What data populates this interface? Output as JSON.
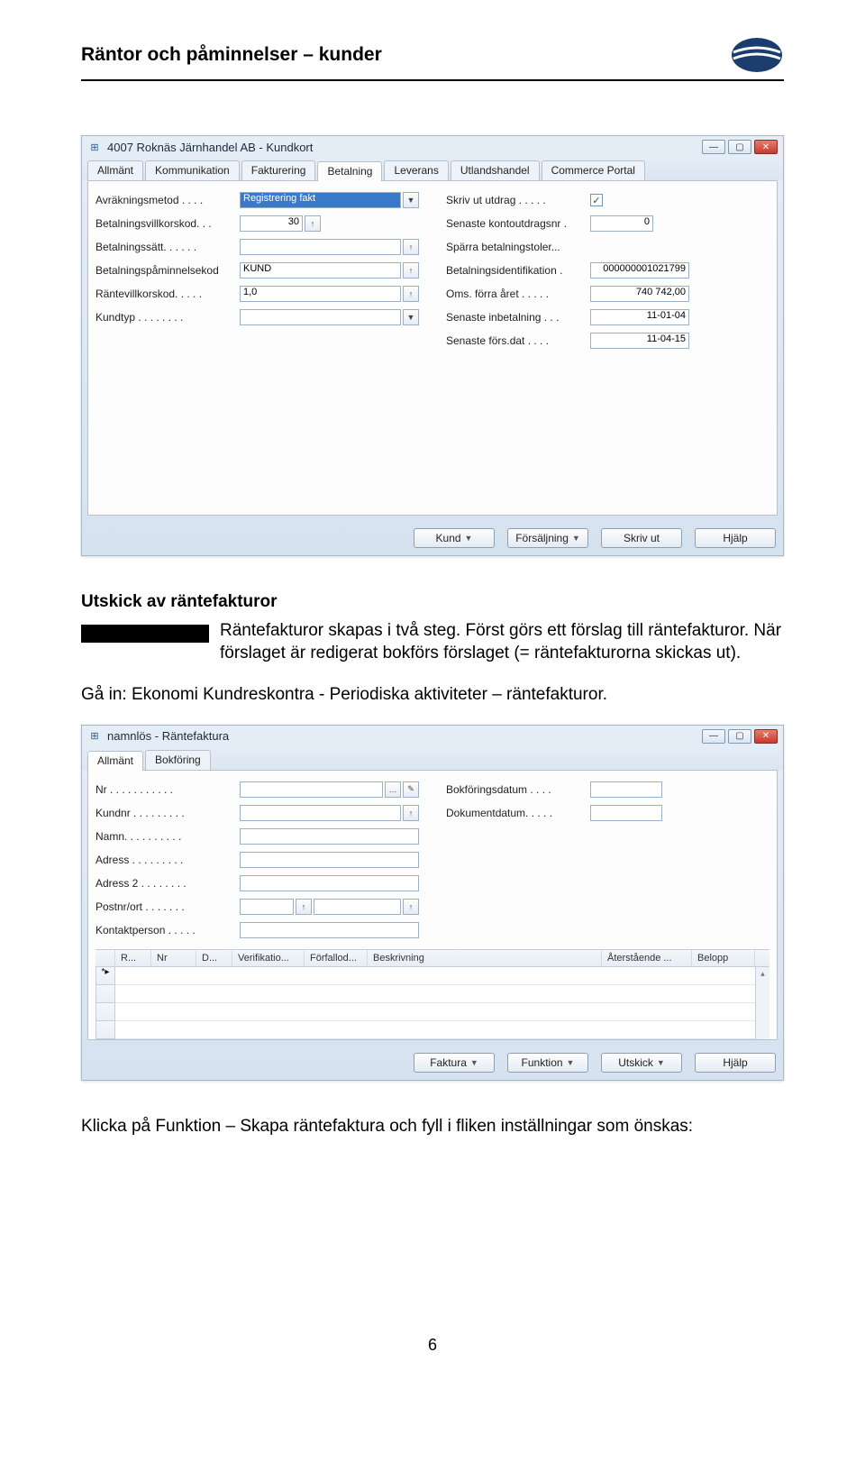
{
  "header": {
    "title": "Räntor och påminnelser – kunder"
  },
  "window1": {
    "title": "4007 Roknäs Järnhandel AB - Kundkort",
    "tabs": [
      "Allmänt",
      "Kommunikation",
      "Fakturering",
      "Betalning",
      "Leverans",
      "Utlandshandel",
      "Commerce Portal"
    ],
    "active_tab": "Betalning",
    "left_fields": [
      {
        "label": "Avräkningsmetod . . . .",
        "value": "Registrering fakt",
        "type": "select"
      },
      {
        "label": "Betalningsvillkorskod. . .",
        "value": "30",
        "type": "pick-small"
      },
      {
        "label": "Betalningssätt. . . . . .",
        "value": "",
        "type": "pick"
      },
      {
        "label": "Betalningspåminnelsekod",
        "value": "KUND",
        "type": "pick-text"
      },
      {
        "label": "Räntevillkorskod. . . . .",
        "value": "1,0",
        "type": "pick-text"
      },
      {
        "label": "Kundtyp . . . . . . . .",
        "value": "",
        "type": "select"
      }
    ],
    "right_fields": [
      {
        "label": "Skriv ut utdrag . . . . .",
        "value": "✓",
        "type": "check"
      },
      {
        "label": "Senaste kontoutdragsnr .",
        "value": "0",
        "type": "small"
      },
      {
        "label": "Spärra betalningstoler...",
        "value": "",
        "type": "blank"
      },
      {
        "label": "Betalningsidentifikation .",
        "value": "000000001021799",
        "type": "med"
      },
      {
        "label": "Oms. förra året . . . . .",
        "value": "740 742,00",
        "type": "med"
      },
      {
        "label": "Senaste inbetalning . . .",
        "value": "11-01-04",
        "type": "med"
      },
      {
        "label": "Senaste förs.dat . . . .",
        "value": "11-04-15",
        "type": "med"
      }
    ],
    "buttons": [
      "Kund",
      "Försäljning",
      "Skriv ut",
      "Hjälp"
    ]
  },
  "section": {
    "heading": "Utskick av räntefakturor",
    "p1": "Räntefakturor skapas i två steg. Först görs ett förslag till räntefakturor. När förslaget är redigerat bokförs förslaget (= räntefakturorna skickas ut).",
    "p2": "Gå in: Ekonomi Kundreskontra - Periodiska aktiviteter – räntefakturor."
  },
  "window2": {
    "title": "namnlös - Räntefaktura",
    "tabs": [
      "Allmänt",
      "Bokföring"
    ],
    "active_tab": "Allmänt",
    "left_fields": [
      {
        "label": "Nr . . . . . . . . . . .",
        "type": "edit-pick"
      },
      {
        "label": "Kundnr . . . . . . . . .",
        "type": "pick"
      },
      {
        "label": "Namn. . . . . . . . . .",
        "type": "text"
      },
      {
        "label": "Adress . . . . . . . . .",
        "type": "text"
      },
      {
        "label": "Adress 2 . . . . . . . .",
        "type": "text"
      },
      {
        "label": "Postnr/ort . . . . . . .",
        "type": "pick2"
      },
      {
        "label": "Kontaktperson . . . . .",
        "type": "text"
      }
    ],
    "right_fields": [
      {
        "label": "Bokföringsdatum . . . .",
        "type": "text"
      },
      {
        "label": "Dokumentdatum. . . . .",
        "type": "text"
      }
    ],
    "grid_headers": [
      "R...",
      "Nr",
      "D...",
      "Verifikatio...",
      "Förfallod...",
      "Beskrivning",
      "Återstående ...",
      "Belopp"
    ],
    "buttons": [
      "Faktura",
      "Funktion",
      "Utskick",
      "Hjälp"
    ]
  },
  "footer_text": "Klicka på Funktion – Skapa räntefaktura och fyll i fliken inställningar som önskas:",
  "page_number": "6"
}
